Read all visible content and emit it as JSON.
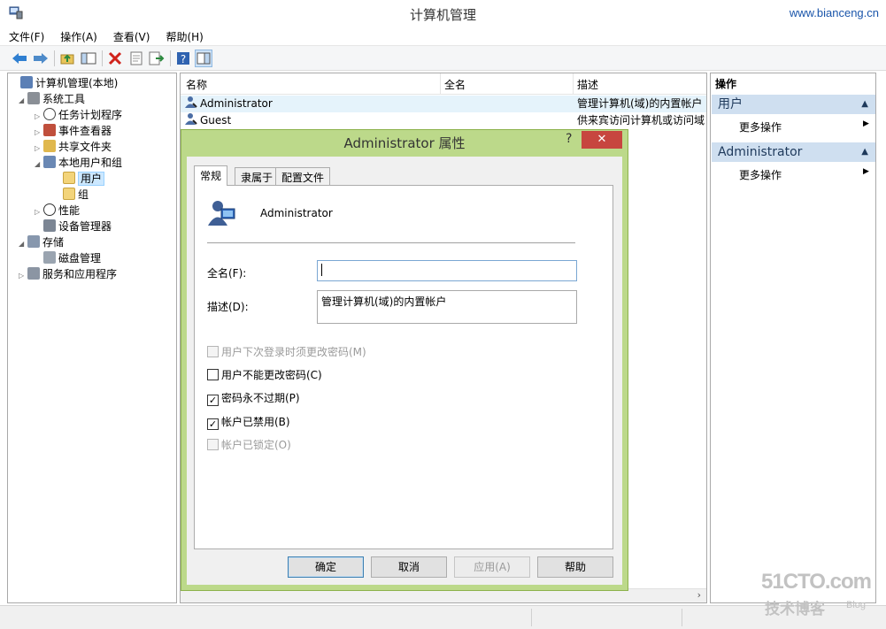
{
  "window": {
    "title": "计算机管理",
    "watermark_url": "www.bianceng.cn"
  },
  "menu": [
    "文件(F)",
    "操作(A)",
    "查看(V)",
    "帮助(H)"
  ],
  "toolbar": {
    "icons": [
      "back-arrow-icon",
      "forward-arrow-icon",
      "up-folder-icon",
      "show-hide-tree-icon",
      "delete-icon",
      "properties-icon",
      "export-list-icon",
      "help-icon",
      "show-hide-action-pane-icon"
    ]
  },
  "tree": [
    {
      "label": "计算机管理(本地)",
      "level": 0,
      "arrow": "",
      "icon": "computer-management-icon"
    },
    {
      "label": "系统工具",
      "level": 1,
      "arrow": "◢",
      "icon": "system-tools-icon"
    },
    {
      "label": "任务计划程序",
      "level": 2,
      "arrow": "▷",
      "icon": "task-scheduler-icon"
    },
    {
      "label": "事件查看器",
      "level": 2,
      "arrow": "▷",
      "icon": "event-viewer-icon"
    },
    {
      "label": "共享文件夹",
      "level": 2,
      "arrow": "▷",
      "icon": "shared-folders-icon"
    },
    {
      "label": "本地用户和组",
      "level": 2,
      "arrow": "◢",
      "icon": "local-users-groups-icon"
    },
    {
      "label": "用户",
      "level": 3,
      "arrow": "",
      "icon": "folder-icon",
      "selected": true
    },
    {
      "label": "组",
      "level": 3,
      "arrow": "",
      "icon": "folder-icon"
    },
    {
      "label": "性能",
      "level": 2,
      "arrow": "▷",
      "icon": "performance-icon"
    },
    {
      "label": "设备管理器",
      "level": 2,
      "arrow": "",
      "icon": "device-manager-icon"
    },
    {
      "label": "存储",
      "level": 1,
      "arrow": "◢",
      "icon": "storage-icon"
    },
    {
      "label": "磁盘管理",
      "level": 2,
      "arrow": "",
      "icon": "disk-management-icon"
    },
    {
      "label": "服务和应用程序",
      "level": 1,
      "arrow": "▷",
      "icon": "services-applications-icon"
    }
  ],
  "list": {
    "columns": [
      "名称",
      "全名",
      "描述"
    ],
    "rows": [
      {
        "name": "Administrator",
        "fullname": "",
        "description": "管理计算机(域)的内置帐户",
        "selected": true
      },
      {
        "name": "Guest",
        "fullname": "",
        "description": "供来宾访问计算机或访问域"
      }
    ]
  },
  "actions": {
    "header": "操作",
    "sections": [
      {
        "title": "用户",
        "item": "更多操作"
      },
      {
        "title": "Administrator",
        "item": "更多操作"
      }
    ]
  },
  "dialog": {
    "title": "Administrator 属性",
    "help": "?",
    "close": "✕",
    "tabs": [
      "常规",
      "隶属于",
      "配置文件"
    ],
    "username": "Administrator",
    "fullname_label": "全名(F):",
    "fullname_value": "",
    "description_label": "描述(D):",
    "description_value": "管理计算机(域)的内置帐户",
    "checkboxes": [
      {
        "label": "用户下次登录时须更改密码(M)",
        "checked": false,
        "disabled": true
      },
      {
        "label": "用户不能更改密码(C)",
        "checked": false,
        "disabled": false
      },
      {
        "label": "密码永不过期(P)",
        "checked": true,
        "disabled": false
      },
      {
        "label": "帐户已禁用(B)",
        "checked": true,
        "disabled": false
      },
      {
        "label": "帐户已锁定(O)",
        "checked": false,
        "disabled": true
      }
    ],
    "buttons": {
      "ok": "确定",
      "cancel": "取消",
      "apply": "应用(A)",
      "help": "帮助"
    }
  },
  "corner_watermark": {
    "big": "51CTO.com",
    "small": "技术博客",
    "blog": "Blog"
  },
  "colors": {
    "accent": "#cfdff0",
    "dialog_frame": "#bcd98a",
    "close_button": "#c7463f",
    "selection": "#cce8ff"
  }
}
